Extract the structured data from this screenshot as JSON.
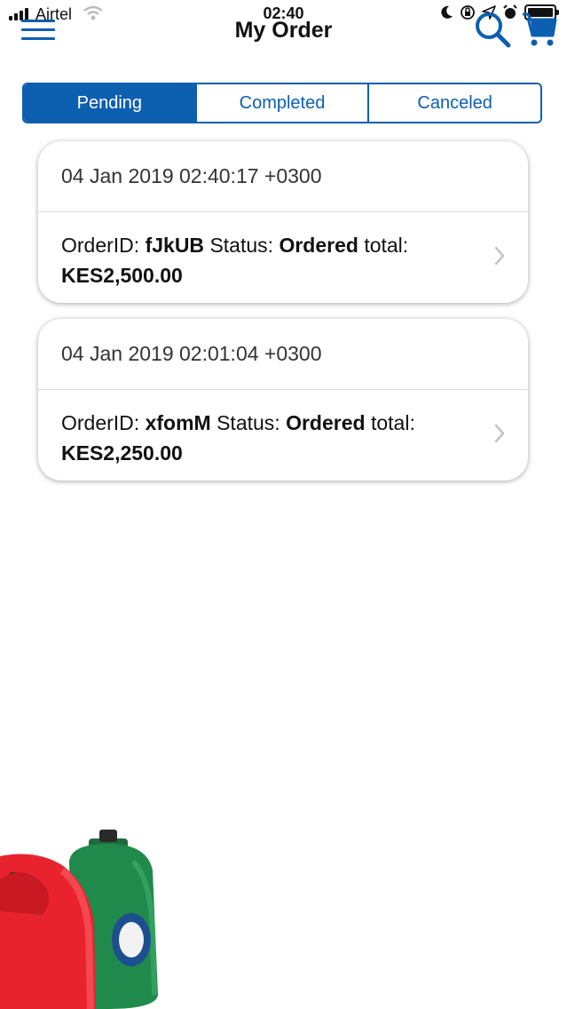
{
  "status_bar": {
    "carrier": "Airtel",
    "time": "02:40"
  },
  "nav": {
    "title": "My Order",
    "menu_icon": "hamburger-icon",
    "search_icon": "search-icon",
    "cart_icon": "cart-icon"
  },
  "tabs": [
    {
      "label": "Pending",
      "active": true
    },
    {
      "label": "Completed",
      "active": false
    },
    {
      "label": "Canceled",
      "active": false
    }
  ],
  "orders": [
    {
      "date": "04 Jan 2019 02:40:17 +0300",
      "order_id_label": "OrderID:",
      "order_id": "fJkUB",
      "status_label": "Status:",
      "status": "Ordered",
      "total_label": "total:",
      "total": "KES2,500.00"
    },
    {
      "date": "04 Jan 2019 02:01:04 +0300",
      "order_id_label": "OrderID:",
      "order_id": "xfomM",
      "status_label": "Status:",
      "status": "Ordered",
      "total_label": "total:",
      "total": "KES2,250.00"
    }
  ],
  "colors": {
    "accent": "#0d5fb0",
    "background": "#ffffff"
  }
}
